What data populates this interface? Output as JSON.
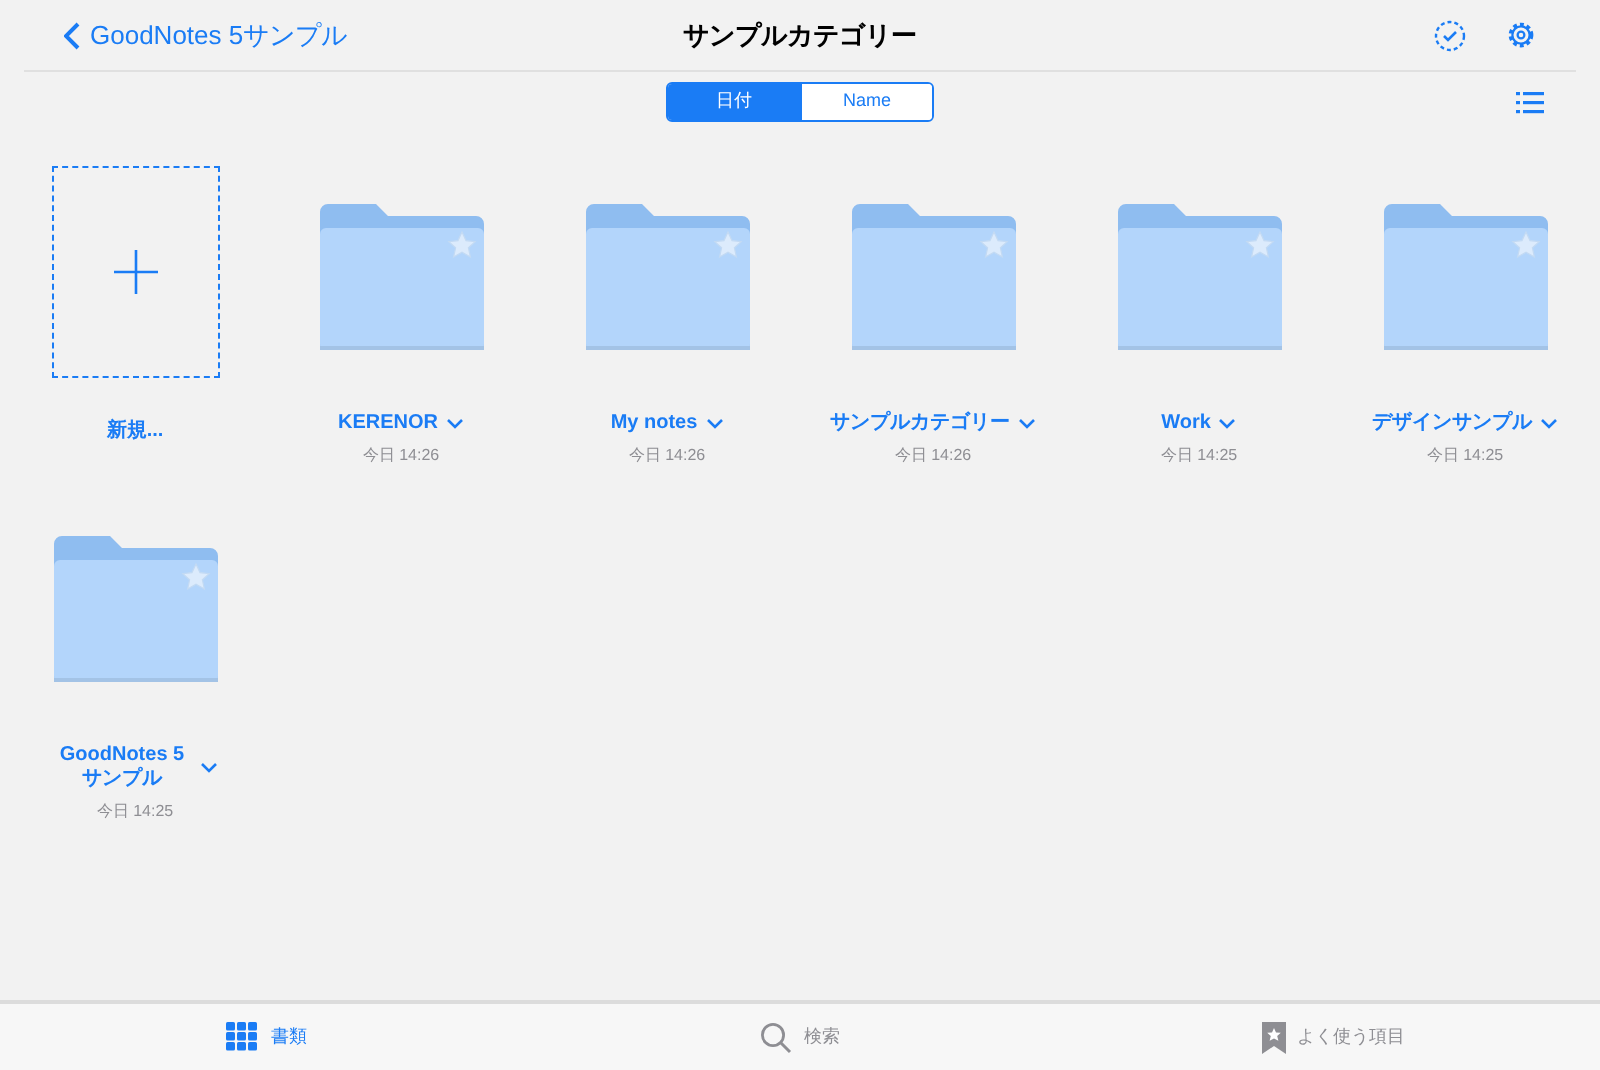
{
  "nav": {
    "back": "GoodNotes 5サンプル",
    "title": "サンプルカテゴリー"
  },
  "sort": [
    {
      "label": "日付",
      "selected": true
    },
    {
      "label": "Name",
      "selected": false
    }
  ],
  "items": [
    {
      "kind": "new",
      "label": "新規..."
    },
    {
      "kind": "folder",
      "label": "KERENOR",
      "date": "今日 14:26"
    },
    {
      "kind": "folder",
      "label": "My notes",
      "date": "今日 14:26"
    },
    {
      "kind": "folder",
      "label": "サンプルカテゴリー",
      "date": "今日 14:26"
    },
    {
      "kind": "folder",
      "label": "Work",
      "date": "今日 14:25"
    },
    {
      "kind": "folder",
      "label": "デザインサンプル",
      "date": "今日 14:25"
    },
    {
      "kind": "folder",
      "label": "GoodNotes 5 サンプル",
      "date": "今日 14:25"
    }
  ],
  "tabs": [
    {
      "kind": "documents",
      "label": "書類",
      "selected": true
    },
    {
      "kind": "search",
      "label": "検索",
      "selected": false
    },
    {
      "kind": "favorites",
      "label": "よく使う項目",
      "selected": false
    }
  ]
}
